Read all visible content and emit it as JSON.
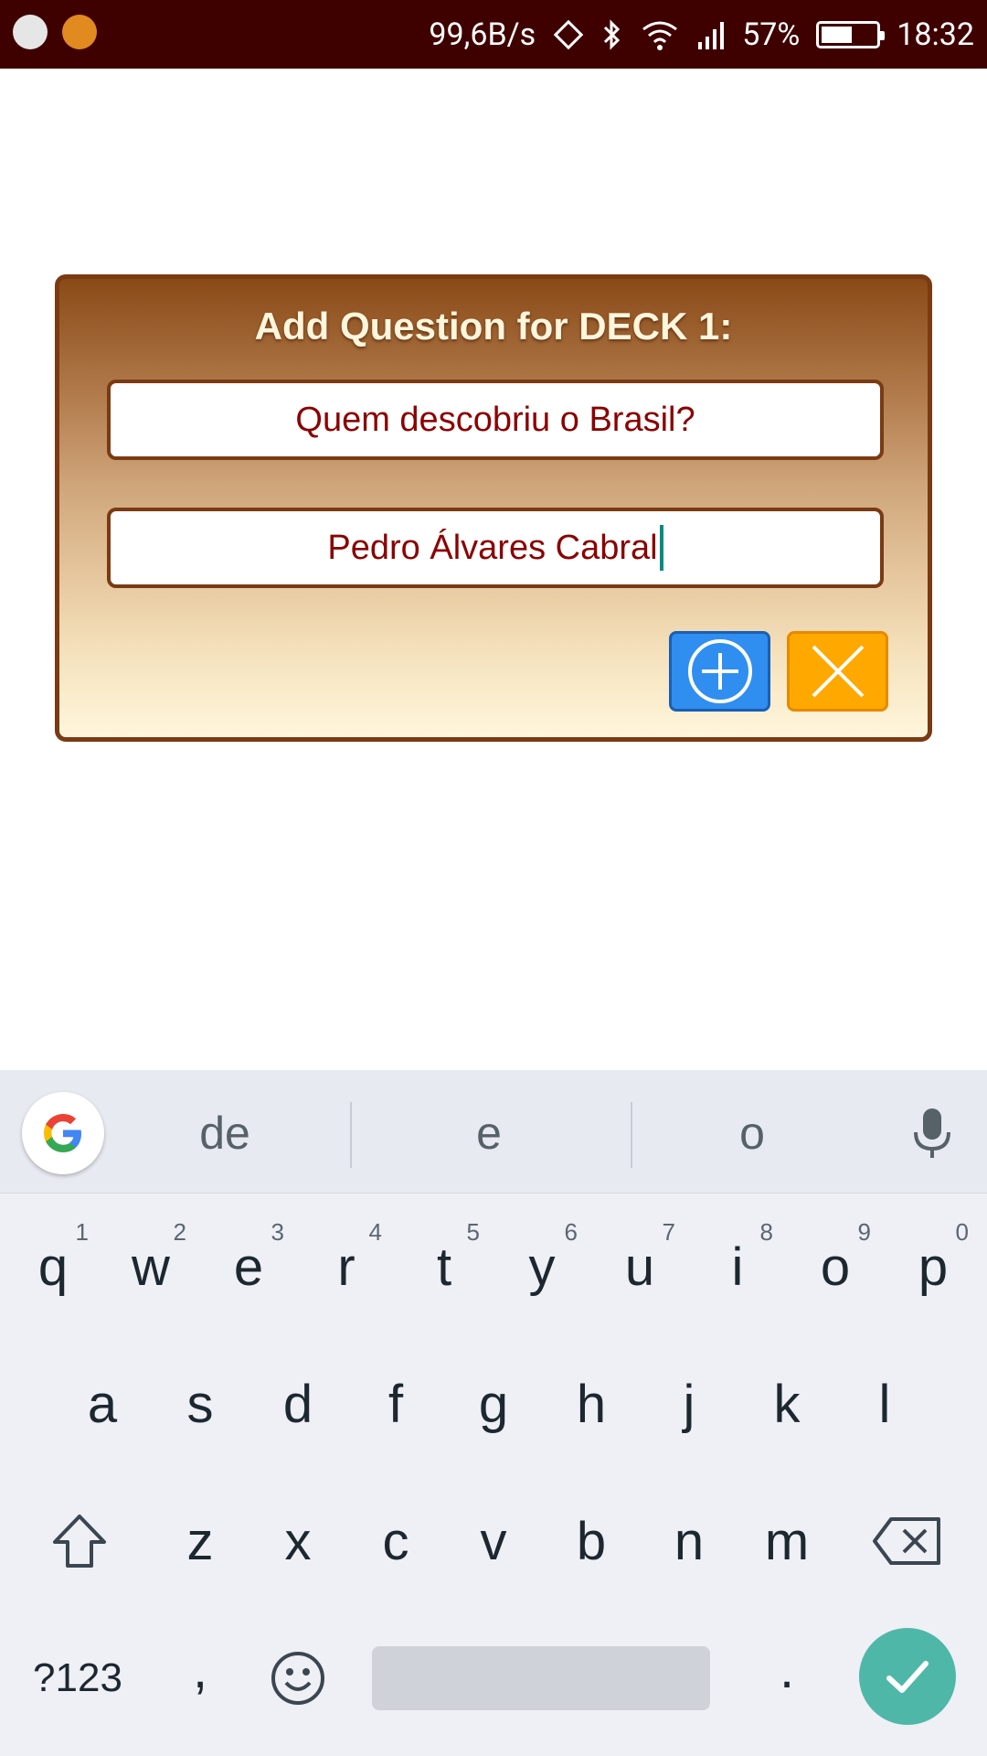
{
  "status_bar": {
    "network_speed": "99,6B/s",
    "battery_percent": "57%",
    "battery_level": 0.57,
    "time": "18:32"
  },
  "dialog": {
    "title": "Add Question for DECK 1:",
    "question_value": "Quem descobriu o Brasil?",
    "answer_value": "Pedro Álvares Cabral",
    "add_icon": "plus-circle-icon",
    "close_icon": "close-icon"
  },
  "keyboard": {
    "suggestions": [
      "de",
      "e",
      "o"
    ],
    "row1": [
      {
        "key": "q",
        "hint": "1"
      },
      {
        "key": "w",
        "hint": "2"
      },
      {
        "key": "e",
        "hint": "3"
      },
      {
        "key": "r",
        "hint": "4"
      },
      {
        "key": "t",
        "hint": "5"
      },
      {
        "key": "y",
        "hint": "6"
      },
      {
        "key": "u",
        "hint": "7"
      },
      {
        "key": "i",
        "hint": "8"
      },
      {
        "key": "o",
        "hint": "9"
      },
      {
        "key": "p",
        "hint": "0"
      }
    ],
    "row2": [
      "a",
      "s",
      "d",
      "f",
      "g",
      "h",
      "j",
      "k",
      "l"
    ],
    "row3": [
      "z",
      "x",
      "c",
      "v",
      "b",
      "n",
      "m"
    ],
    "symbols_key": "?123",
    "comma_key": ",",
    "period_key": ".",
    "colors": {
      "enter": "#4fb7a8",
      "background": "#eef0f6"
    }
  },
  "colors": {
    "status_bar": "#3f0000",
    "dialog_border": "#7a3a12",
    "field_text": "#8b0000",
    "add_button": "#2f8ef0",
    "close_button": "#ffa800"
  }
}
